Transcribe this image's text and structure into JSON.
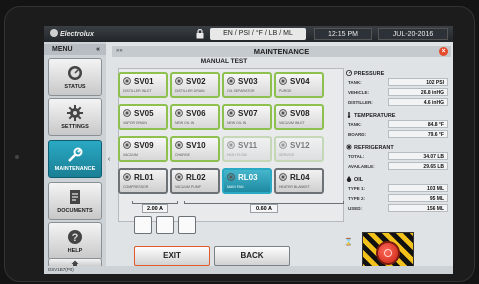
{
  "topbar": {
    "logo": "Electrolux",
    "units": "EN / PSI / °F / LB / ML",
    "time": "12:15 PM",
    "date": "JUL-20-2016"
  },
  "sidebar": {
    "title": "MENU",
    "items": [
      {
        "label": "STATUS",
        "icon": "gauge-icon"
      },
      {
        "label": "SETTINGS",
        "icon": "gear-icon"
      },
      {
        "label": "MAINTENANCE",
        "icon": "wrench-icon"
      },
      {
        "label": "DOCUMENTS",
        "icon": "document-icon"
      },
      {
        "label": "HELP",
        "icon": "help-icon"
      },
      {
        "label": "",
        "icon": "home-icon"
      }
    ]
  },
  "main": {
    "title": "MAINTENANCE",
    "subtitle": "MANUAL TEST",
    "tiles": [
      {
        "name": "SV01",
        "sub": "DISTILLER INLET",
        "state": "green"
      },
      {
        "name": "SV02",
        "sub": "DISTILLER DRAIN",
        "state": "green"
      },
      {
        "name": "SV03",
        "sub": "OIL SEPARATOR",
        "state": "green"
      },
      {
        "name": "SV04",
        "sub": "PURGE",
        "state": "green"
      },
      {
        "name": "SV05",
        "sub": "VAPOR DRAIN",
        "state": "green"
      },
      {
        "name": "SV06",
        "sub": "NEW OIL IN",
        "state": "green"
      },
      {
        "name": "SV07",
        "sub": "NEW OIL IN",
        "state": "green"
      },
      {
        "name": "SV08",
        "sub": "VACUUM INLET",
        "state": "green"
      },
      {
        "name": "SV09",
        "sub": "VACUUM",
        "state": "green"
      },
      {
        "name": "SV10",
        "sub": "CHARGE",
        "state": "green"
      },
      {
        "name": "SV11",
        "sub": "HIGH FLOW",
        "state": "dim"
      },
      {
        "name": "SV12",
        "sub": "SERVICE",
        "state": "dim"
      },
      {
        "name": "RL01",
        "sub": "COMPRESSOR",
        "state": "rl"
      },
      {
        "name": "RL02",
        "sub": "VACUUM PUMP",
        "state": "rl"
      },
      {
        "name": "RL03",
        "sub": "MAIN FAN",
        "state": "on"
      },
      {
        "name": "RL04",
        "sub": "HEATER BLANKET",
        "state": "rl"
      }
    ],
    "amps": [
      "2.00 A",
      "0.60 A"
    ],
    "buttons": {
      "exit": "EXIT",
      "back": "BACK"
    }
  },
  "readings": {
    "pressure": {
      "title": "PRESSURE",
      "rows": [
        {
          "label": "TANK:",
          "value": "102 PSI"
        },
        {
          "label": "VEHICLE:",
          "value": "26.8 inHG"
        },
        {
          "label": "DISTILLER:",
          "value": "4.6 inHG"
        }
      ]
    },
    "temperature": {
      "title": "TEMPERATURE",
      "rows": [
        {
          "label": "TANK:",
          "value": "84.8 °F"
        },
        {
          "label": "BOARD:",
          "value": "79.6 °F"
        }
      ]
    },
    "refrigerant": {
      "title": "REFRIGERANT",
      "rows": [
        {
          "label": "TOTAL:",
          "value": "34.07 LB"
        },
        {
          "label": "AVAILABLE:",
          "value": "29.65 LB"
        }
      ]
    },
    "oil": {
      "title": "OIL",
      "rows": [
        {
          "label": "TYPE 1:",
          "value": "103 ML"
        },
        {
          "label": "TYPE 2:",
          "value": "95 ML"
        },
        {
          "label": "USED:",
          "value": "156 ML"
        }
      ]
    }
  },
  "statusbar": {
    "text": "DSV1B7(P0)"
  },
  "colors": {
    "accent": "#2aa9c4",
    "tile_border": "#8dc04f",
    "exit_border": "#e05a2b"
  }
}
